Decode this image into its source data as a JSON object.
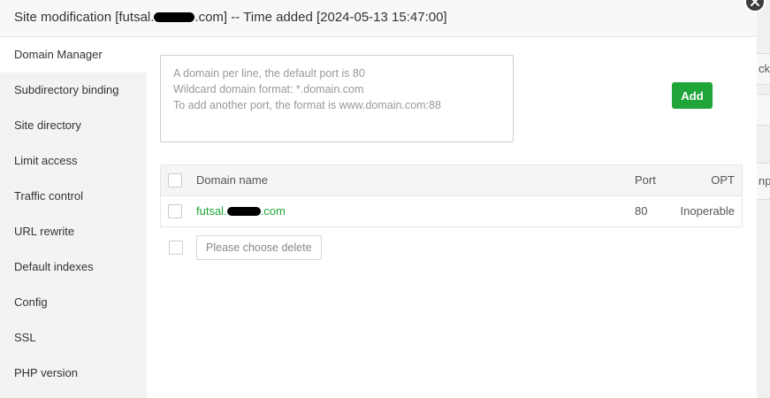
{
  "window": {
    "title_prefix": "Site modification [futsal.",
    "title_suffix": ".com] -- Time added [2024-05-13 15:47:00]"
  },
  "background_fragments": [
    "ck",
    "np"
  ],
  "sidebar": {
    "items": [
      {
        "label": "Domain Manager",
        "active": true
      },
      {
        "label": "Subdirectory binding"
      },
      {
        "label": "Site directory"
      },
      {
        "label": "Limit access"
      },
      {
        "label": "Traffic control"
      },
      {
        "label": "URL rewrite"
      },
      {
        "label": "Default indexes"
      },
      {
        "label": "Config"
      },
      {
        "label": "SSL"
      },
      {
        "label": "PHP version"
      }
    ]
  },
  "domain_form": {
    "placeholder_lines": [
      "A domain per line, the default port is 80",
      "Wildcard domain format: *.domain.com",
      "To add another port, the format is www.domain.com:88"
    ],
    "add_label": "Add"
  },
  "table": {
    "headers": {
      "name": "Domain name",
      "port": "Port",
      "opt": "OPT"
    },
    "rows": [
      {
        "name_prefix": "futsal.",
        "name_suffix": ".com",
        "port": "80",
        "opt": "Inoperable"
      }
    ]
  },
  "footer": {
    "delete_label": "Please choose delete"
  },
  "colors": {
    "accent": "#20a53a",
    "sidebar_bg": "#f3f3f3",
    "title_bg": "#f8f8f8"
  }
}
